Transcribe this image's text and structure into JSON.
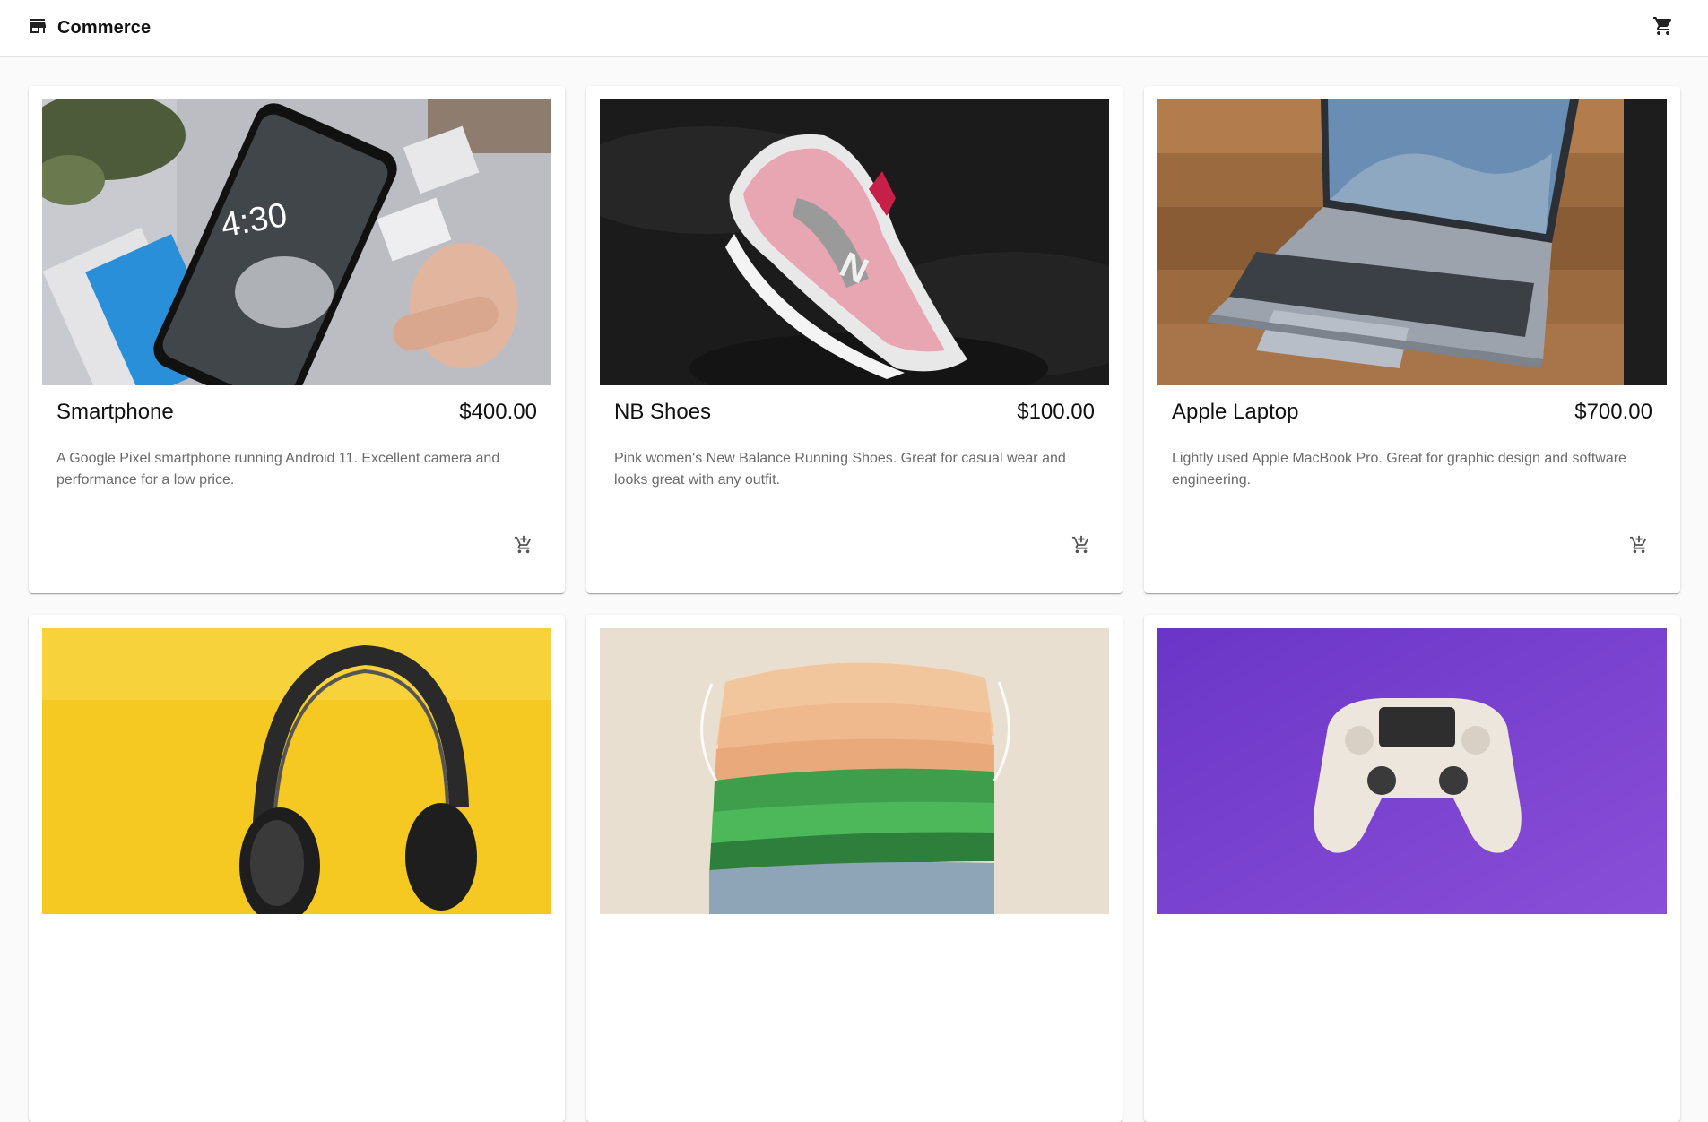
{
  "app": {
    "title": "Commerce",
    "store_icon": "store-icon",
    "cart_icon": "shopping-cart-icon"
  },
  "products": [
    {
      "name": "Smartphone",
      "price": "$400.00",
      "description": "A Google Pixel smartphone running Android 11. Excellent camera and performance for a low price.",
      "image": "phone-photo"
    },
    {
      "name": "NB Shoes",
      "price": "$100.00",
      "description": "Pink women's New Balance Running Shoes. Great for casual wear and looks great with any outfit.",
      "image": "shoe-photo"
    },
    {
      "name": "Apple Laptop",
      "price": "$700.00",
      "description": "Lightly used Apple MacBook Pro. Great for graphic design and software engineering.",
      "image": "laptop-photo"
    },
    {
      "image": "headphones-photo"
    },
    {
      "image": "face-masks-photo"
    },
    {
      "image": "game-controller-photo"
    }
  ],
  "card_action_icon": "add-shopping-cart-icon",
  "colors": {
    "background": "#fafafa",
    "appbar": "#ffffff",
    "text": "#212121",
    "muted": "#6b6b6b"
  }
}
